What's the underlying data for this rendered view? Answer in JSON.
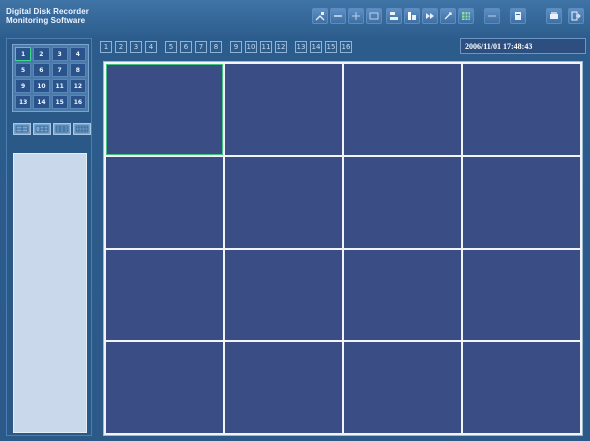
{
  "app": {
    "title": "Digital Disk Recorder\nMonitoring Software",
    "datetime": "2006/11/01  17:48:43"
  },
  "toolbar": {
    "group1": [
      "zoom-icon",
      "zoom-out-icon",
      "split-icon",
      "layout-icon"
    ],
    "group2": [
      "tree-icon",
      "camera-ctrl-icon",
      "fast-icon",
      "settings-icon",
      "grid-icon"
    ],
    "group3": [
      "separator-icon"
    ],
    "group4": [
      "record-icon"
    ],
    "group5": [
      "print-icon",
      "exit-icon"
    ]
  },
  "channels": [
    "1",
    "2",
    "3",
    "4",
    "5",
    "6",
    "7",
    "8",
    "9",
    "10",
    "11",
    "12",
    "13",
    "14",
    "15",
    "16"
  ],
  "active_channel": "1",
  "camera_buttons": [
    "1",
    "2",
    "3",
    "4",
    "5",
    "6",
    "7",
    "8",
    "9",
    "10",
    "11",
    "12",
    "13",
    "14",
    "15",
    "16"
  ],
  "layouts": [
    "quad-layout-icon",
    "split-layout-icon",
    "nine-layout-icon",
    "sixteen-layout-icon"
  ],
  "colors": {
    "tile": "#3a4d84",
    "accent": "#41c27d",
    "frame": "#2b5a89"
  }
}
